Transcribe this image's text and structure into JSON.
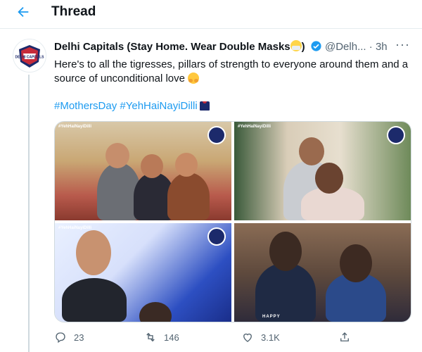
{
  "header": {
    "title": "Thread"
  },
  "tweet": {
    "author": "Delhi Capitals (Stay Home. Wear Double Masks",
    "author_close": ")",
    "handle": "@Delh...",
    "separator": "·",
    "time": "3h",
    "text": "Here's to all the tigresses, pillars of strength to everyone around them and a source of unconditional love",
    "hashtags": [
      "#MothersDay",
      "#YehHaiNayiDilli"
    ],
    "photos": [
      "#YehHaiNayiDilli",
      "#YehHaiNayiDilli",
      "#YehHaiNayiDilli",
      "#YehHaiNayiDilli"
    ],
    "photo4_caption": "HAPPY",
    "avatar_text": "DELHI CAPITALS"
  },
  "actions": {
    "replies": "23",
    "retweets": "146",
    "likes": "3.1K"
  },
  "colors": {
    "accent": "#1d9bf0",
    "muted": "#536471",
    "brand_navy": "#1c2a6b",
    "brand_red": "#c62c3a"
  },
  "icons": [
    "back-arrow-icon",
    "verified-badge-icon",
    "more-icon",
    "reply-icon",
    "retweet-icon",
    "like-icon",
    "share-icon"
  ]
}
